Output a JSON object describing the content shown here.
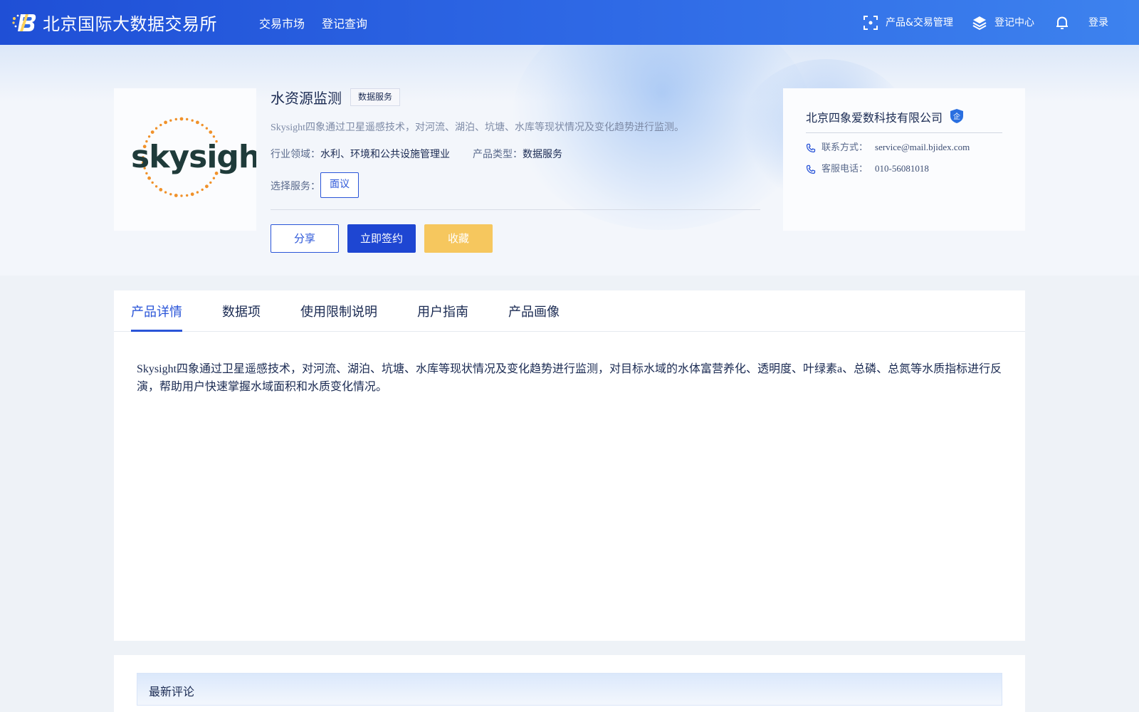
{
  "header": {
    "site_title": "北京国际大数据交易所",
    "nav": [
      "交易市场",
      "登记查询"
    ],
    "product_trade_mgmt": "产品&交易管理",
    "register_center": "登记中心",
    "login": "登录",
    "icons": [
      "scan-icon",
      "layers-icon",
      "bell-icon"
    ]
  },
  "product": {
    "logo_text": "skysight",
    "title": "水资源监测",
    "tag": "数据服务",
    "description": "Skysight四象通过卫星遥感技术，对河流、湖泊、坑塘、水库等现状情况及变化趋势进行监测。",
    "industry_label": "行业领域：",
    "industry_value": "水利、环境和公共设施管理业",
    "type_label": "产品类型：",
    "type_value": "数据服务",
    "service_label": "选择服务：",
    "service_option": "面议",
    "buttons": {
      "share": "分享",
      "sign": "立即签约",
      "favorite": "收藏"
    }
  },
  "company": {
    "name": "北京四象爱数科技有限公司",
    "badge": "企",
    "contact_label": "联系方式：",
    "contact_value": "service@mail.bjidex.com",
    "phone_label": "客服电话：",
    "phone_value": "010-56081018"
  },
  "tabs": {
    "items": [
      "产品详情",
      "数据项",
      "使用限制说明",
      "用户指南",
      "产品画像"
    ],
    "active_index": 0
  },
  "detail": {
    "text": "Skysight四象通过卫星遥感技术，对河流、湖泊、坑塘、水库等现状情况及变化趋势进行监测，对目标水域的水体富营养化、透明度、叶绿素a、总磷、总氮等水质指标进行反演，帮助用户快速掌握水域面积和水质变化情况。"
  },
  "comments": {
    "title": "最新评论"
  },
  "colors": {
    "primary": "#1e46d2",
    "accent": "#2a55d8",
    "favorite": "#f6c75e",
    "logo_orange": "#f0912a",
    "logo_dark": "#1f3b3a"
  }
}
